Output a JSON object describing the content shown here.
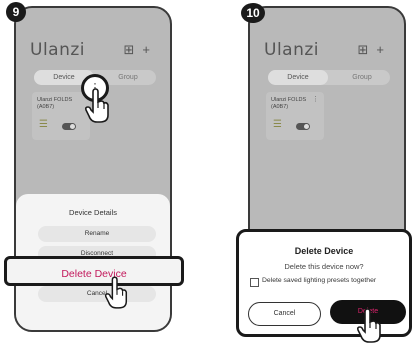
{
  "steps": {
    "step1": "9",
    "step2": "10"
  },
  "app": {
    "logo": "Ulanzi"
  },
  "header": {
    "grid_icon": "grid-icon",
    "add_icon": "plus-icon"
  },
  "tabs": [
    {
      "label": "Device"
    },
    {
      "label": "Group"
    }
  ],
  "device_card": {
    "name_line1": "Ulanzi FOLDS",
    "name_line2": "(A0B7)",
    "menu_icon": "more-vertical-icon"
  },
  "sheet": {
    "title": "Device Details",
    "items": [
      "Rename",
      "Disconnect",
      "Delete Device",
      "Cancel"
    ]
  },
  "dialog": {
    "title": "Delete Device",
    "message": "Delete this device now?",
    "checkbox_label": "Delete saved lighting presets together",
    "cancel_label": "Cancel",
    "delete_label": "Delete"
  },
  "colors": {
    "delete_text": "#c2185b",
    "dialog_delete_text": "#e0246f",
    "phone_dim": "#b9b9b9"
  }
}
